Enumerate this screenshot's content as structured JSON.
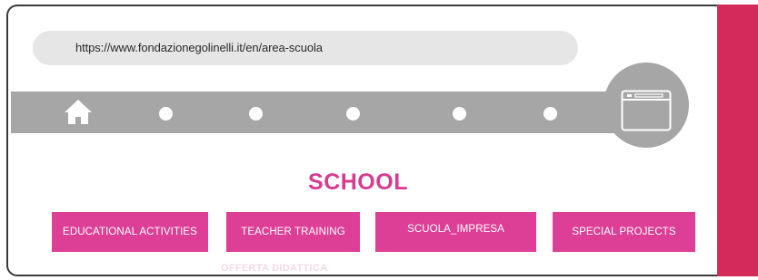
{
  "browser": {
    "url": "https://www.fondazionegolinelli.it/en/area-scuola"
  },
  "nav": {
    "icons": [
      "home-icon",
      "browser-window-icon"
    ]
  },
  "section": {
    "title": "SCHOOL"
  },
  "tabs": [
    {
      "label": "EDUCATIONAL ACTIVITIES"
    },
    {
      "label": "TEACHER TRAINING"
    },
    {
      "label": "SCUOLA_IMPRESA"
    },
    {
      "label": "SPECIAL PROJECTS"
    }
  ],
  "ghost_text": "OFFERTA DIDATTICA",
  "colors": {
    "accent": "#dd3f96",
    "heading": "#d63b8f",
    "side_band": "#d42a59",
    "nav_gray": "#a6a6a6",
    "url_bar": "#e6e6e6"
  }
}
